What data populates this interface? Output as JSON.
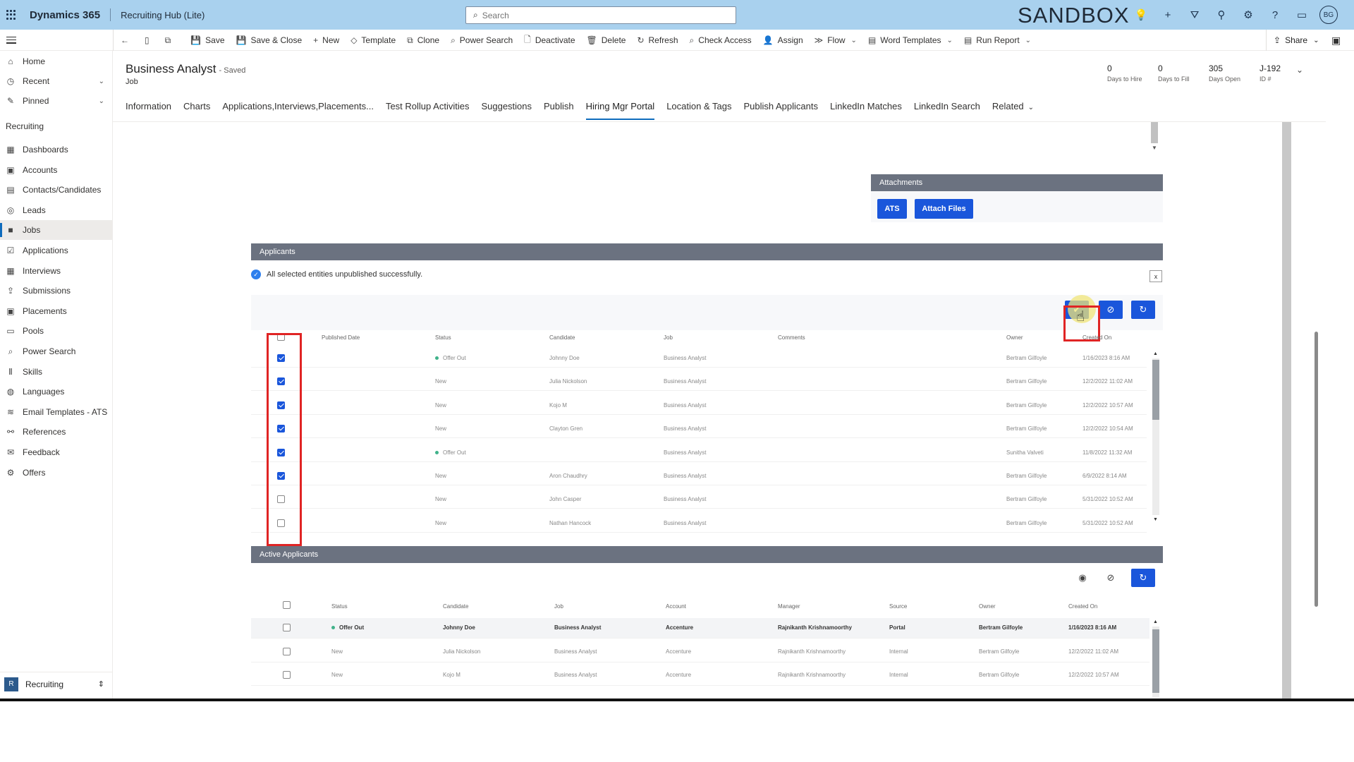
{
  "topbar": {
    "brand": "Dynamics 365",
    "app_name": "Recruiting Hub (Lite)",
    "search_placeholder": "Search",
    "environment": "SANDBOX",
    "avatar_initials": "BG"
  },
  "commands": [
    {
      "icon": "←",
      "label": ""
    },
    {
      "icon": "▯",
      "label": ""
    },
    {
      "icon": "⧉",
      "label": ""
    },
    {
      "icon": "💾",
      "label": "Save"
    },
    {
      "icon": "💾",
      "label": "Save & Close"
    },
    {
      "icon": "+",
      "label": "New"
    },
    {
      "icon": "◇",
      "label": "Template"
    },
    {
      "icon": "⧉",
      "label": "Clone"
    },
    {
      "icon": "⌕",
      "label": "Power Search"
    },
    {
      "icon": "🗋",
      "label": "Deactivate"
    },
    {
      "icon": "🗑",
      "label": "Delete"
    },
    {
      "icon": "↻",
      "label": "Refresh"
    },
    {
      "icon": "⌕",
      "label": "Check Access"
    },
    {
      "icon": "👤",
      "label": "Assign"
    },
    {
      "icon": "≫",
      "label": "Flow"
    },
    {
      "icon": "▤",
      "label": "Word Templates"
    },
    {
      "icon": "▤",
      "label": "Run Report"
    }
  ],
  "share_label": "Share",
  "sidebar": {
    "items": [
      {
        "icon": "⌂",
        "label": "Home"
      },
      {
        "icon": "◷",
        "label": "Recent"
      },
      {
        "icon": "✎",
        "label": "Pinned"
      }
    ],
    "group_label": "Recruiting",
    "group_items": [
      {
        "icon": "▦",
        "label": "Dashboards"
      },
      {
        "icon": "▣",
        "label": "Accounts"
      },
      {
        "icon": "▤",
        "label": "Contacts/Candidates"
      },
      {
        "icon": "◎",
        "label": "Leads"
      },
      {
        "icon": "■",
        "label": "Jobs"
      },
      {
        "icon": "☑",
        "label": "Applications"
      },
      {
        "icon": "▦",
        "label": "Interviews"
      },
      {
        "icon": "⇪",
        "label": "Submissions"
      },
      {
        "icon": "▣",
        "label": "Placements"
      },
      {
        "icon": "▭",
        "label": "Pools"
      },
      {
        "icon": "⌕",
        "label": "Power Search"
      },
      {
        "icon": "Ⅱ",
        "label": "Skills"
      },
      {
        "icon": "◍",
        "label": "Languages"
      },
      {
        "icon": "≋",
        "label": "Email Templates - ATS"
      },
      {
        "icon": "⚯",
        "label": "References"
      },
      {
        "icon": "✉",
        "label": "Feedback"
      },
      {
        "icon": "⚙",
        "label": "Offers"
      }
    ],
    "area": {
      "badge": "R",
      "label": "Recruiting"
    }
  },
  "form": {
    "title": "Business Analyst",
    "saved_status": "- Saved",
    "entity": "Job",
    "stats": [
      {
        "value": "0",
        "label": "Days to Hire"
      },
      {
        "value": "0",
        "label": "Days to Fill"
      },
      {
        "value": "305",
        "label": "Days Open"
      },
      {
        "value": "J-192",
        "label": "ID #"
      }
    ],
    "tabs": [
      "Information",
      "Charts",
      "Applications,Interviews,Placements...",
      "Test Rollup Activities",
      "Suggestions",
      "Publish",
      "Hiring Mgr Portal",
      "Location & Tags",
      "Publish Applicants",
      "LinkedIn Matches",
      "LinkedIn Search",
      "Related"
    ],
    "active_tab": "Hiring Mgr Portal"
  },
  "attachments": {
    "title": "Attachments",
    "ats_label": "ATS",
    "attach_label": "Attach Files"
  },
  "applicants": {
    "title": "Applicants",
    "notice": "All selected entities unpublished successfully.",
    "close_label": "x",
    "columns": [
      "Published Date",
      "Status",
      "Candidate",
      "Job",
      "Comments",
      "Owner",
      "Created On"
    ],
    "rows": [
      {
        "checked": true,
        "status": "Offer Out",
        "status_dot": true,
        "candidate": "Johnny Doe",
        "job": "Business Analyst",
        "owner": "Bertram Gilfoyle",
        "created": "1/16/2023 8:16 AM"
      },
      {
        "checked": true,
        "status": "New",
        "status_dot": false,
        "candidate": "Julia Nickolson",
        "job": "Business Analyst",
        "owner": "Bertram Gilfoyle",
        "created": "12/2/2022 11:02 AM"
      },
      {
        "checked": true,
        "status": "New",
        "status_dot": false,
        "candidate": "Kojo M",
        "job": "Business Analyst",
        "owner": "Bertram Gilfoyle",
        "created": "12/2/2022 10:57 AM"
      },
      {
        "checked": true,
        "status": "New",
        "status_dot": false,
        "candidate": "Clayton Gren",
        "job": "Business Analyst",
        "owner": "Bertram Gilfoyle",
        "created": "12/2/2022 10:54 AM"
      },
      {
        "checked": true,
        "status": "Offer Out",
        "status_dot": true,
        "candidate": "",
        "job": "Business Analyst",
        "owner": "Sunitha Valveti",
        "created": "11/8/2022 11:32 AM"
      },
      {
        "checked": true,
        "status": "New",
        "status_dot": false,
        "candidate": "Aron Chaudhry",
        "job": "Business Analyst",
        "owner": "Bertram Gilfoyle",
        "created": "6/9/2022 8:14 AM"
      },
      {
        "checked": false,
        "status": "New",
        "status_dot": false,
        "candidate": "John Casper",
        "job": "Business Analyst",
        "owner": "Bertram Gilfoyle",
        "created": "5/31/2022 10:52 AM"
      },
      {
        "checked": false,
        "status": "New",
        "status_dot": false,
        "candidate": "Nathan Hancock",
        "job": "Business Analyst",
        "owner": "Bertram Gilfoyle",
        "created": "5/31/2022 10:52 AM"
      }
    ]
  },
  "active_applicants": {
    "title": "Active Applicants",
    "columns": [
      "Status",
      "Candidate",
      "Job",
      "Account",
      "Manager",
      "Source",
      "Owner",
      "Created On"
    ],
    "rows": [
      {
        "status": "Offer Out",
        "status_dot": true,
        "candidate": "Johnny Doe",
        "job": "Business Analyst",
        "account": "Accenture",
        "manager": "Rajnikanth Krishnamoorthy",
        "source": "Portal",
        "owner": "Bertram Gilfoyle",
        "created": "1/16/2023 8:16 AM",
        "bold": true
      },
      {
        "status": "New",
        "status_dot": false,
        "candidate": "Julia Nickolson",
        "job": "Business Analyst",
        "account": "Accenture",
        "manager": "Rajnikanth Krishnamoorthy",
        "source": "Internal",
        "owner": "Bertram Gilfoyle",
        "created": "12/2/2022 11:02 AM",
        "bold": false
      },
      {
        "status": "New",
        "status_dot": false,
        "candidate": "Kojo M",
        "job": "Business Analyst",
        "account": "Accenture",
        "manager": "Rajnikanth Krishnamoorthy",
        "source": "Internal",
        "owner": "Bertram Gilfoyle",
        "created": "12/2/2022 10:57 AM",
        "bold": false
      }
    ]
  }
}
